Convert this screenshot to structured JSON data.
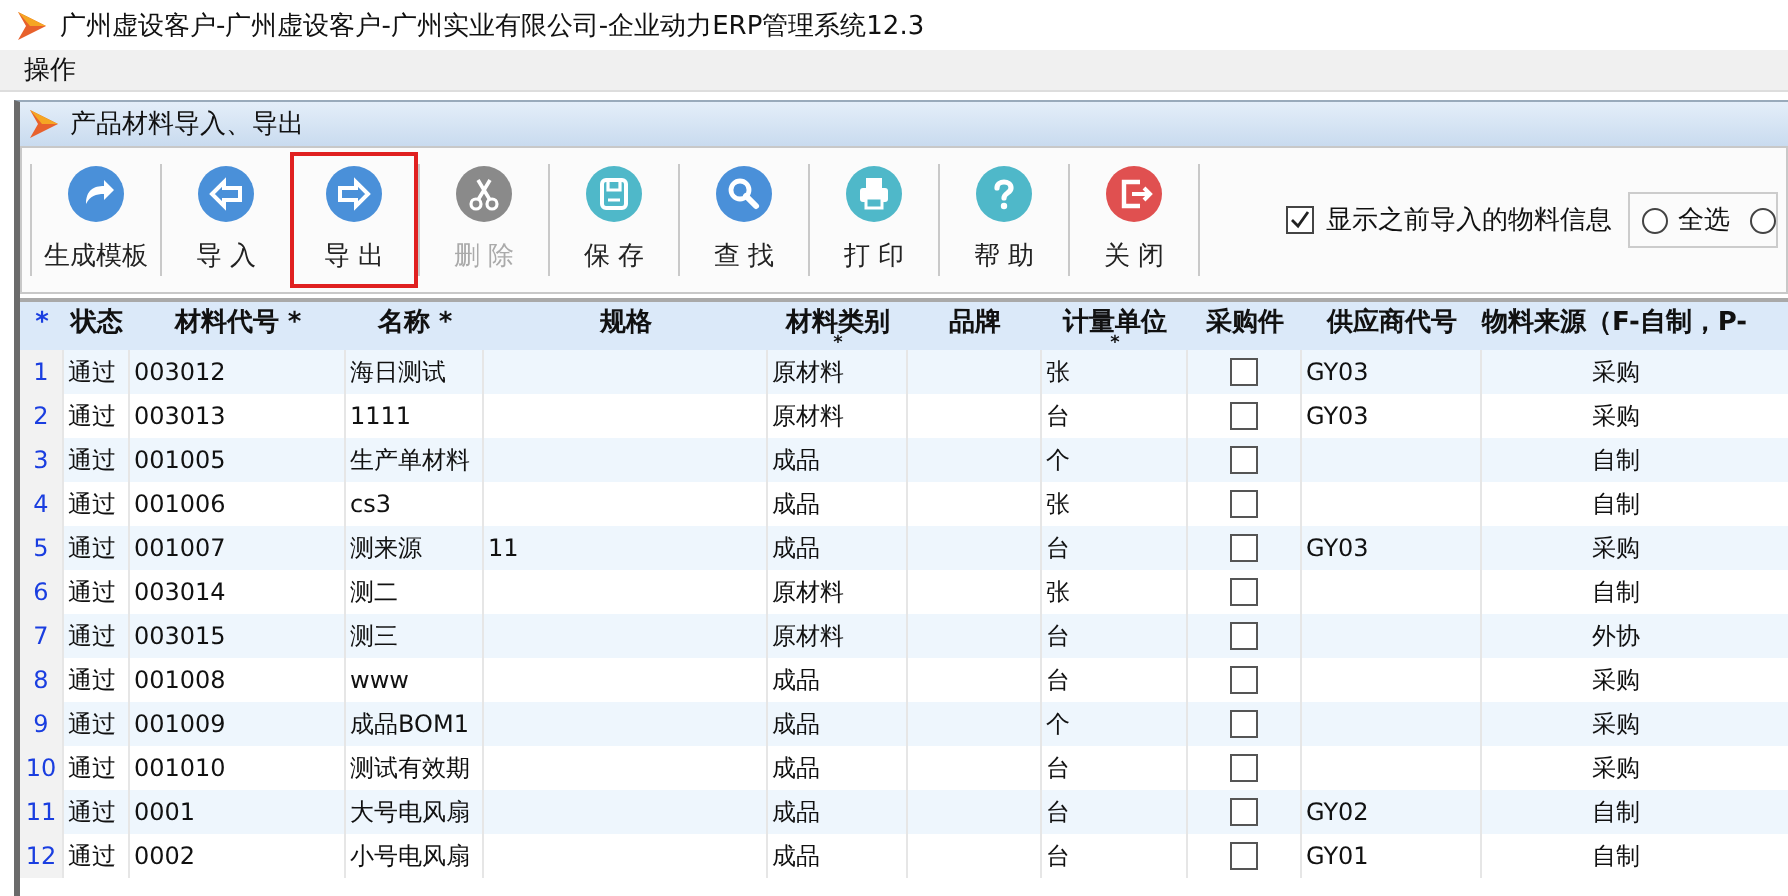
{
  "window": {
    "title": "广州虚设客户-广州虚设客户-广州实业有限公司-企业动力ERP管理系统12.3"
  },
  "menu": [
    "操作"
  ],
  "subwindow": {
    "title": "产品材料导入、导出"
  },
  "toolbar": [
    {
      "kind": "template",
      "label": "生成模板",
      "disabled": false,
      "highlighted": false
    },
    {
      "kind": "import",
      "label": "导 入",
      "disabled": false,
      "highlighted": false
    },
    {
      "kind": "export",
      "label": "导 出",
      "disabled": false,
      "highlighted": true
    },
    {
      "kind": "delete",
      "label": "删 除",
      "disabled": true,
      "highlighted": false
    },
    {
      "kind": "save",
      "label": "保 存",
      "disabled": false,
      "highlighted": false
    },
    {
      "kind": "find",
      "label": "查 找",
      "disabled": false,
      "highlighted": false
    },
    {
      "kind": "print",
      "label": "打 印",
      "disabled": false,
      "highlighted": false
    },
    {
      "kind": "help",
      "label": "帮 助",
      "disabled": false,
      "highlighted": false
    },
    {
      "kind": "close",
      "label": "关 闭",
      "disabled": false,
      "highlighted": false
    }
  ],
  "show_previous": {
    "label": "显示之前导入的物料信息",
    "checked": true
  },
  "radios": [
    {
      "label": "全选",
      "selected": false
    },
    {
      "selected": false
    }
  ],
  "table": {
    "columns": [
      {
        "label": "*"
      },
      {
        "label": "状态"
      },
      {
        "label": "材料代号",
        "mark": "*"
      },
      {
        "label": "名称",
        "mark": "*"
      },
      {
        "label": "规格"
      },
      {
        "label": "材料类别",
        "mark_below": "*"
      },
      {
        "label": "品牌"
      },
      {
        "label": "计量单位",
        "mark_below": "*"
      },
      {
        "label": "采购件"
      },
      {
        "label": "供应商代号"
      },
      {
        "label": "物料来源（F-自制，P-"
      }
    ],
    "rows": [
      {
        "no": "1",
        "status": "通过",
        "code": "003012",
        "name": "海日测试",
        "spec": "",
        "category": "原材料",
        "brand": "",
        "unit": "张",
        "purchased": false,
        "supplier": "GY03",
        "source": "采购"
      },
      {
        "no": "2",
        "status": "通过",
        "code": "003013",
        "name": "1111",
        "spec": "",
        "category": "原材料",
        "brand": "",
        "unit": "台",
        "purchased": false,
        "supplier": "GY03",
        "source": "采购"
      },
      {
        "no": "3",
        "status": "通过",
        "code": "001005",
        "name": "生产单材料",
        "spec": "",
        "category": "成品",
        "brand": "",
        "unit": "个",
        "purchased": false,
        "supplier": "",
        "source": "自制"
      },
      {
        "no": "4",
        "status": "通过",
        "code": "001006",
        "name": "cs3",
        "spec": "",
        "category": "成品",
        "brand": "",
        "unit": "张",
        "purchased": false,
        "supplier": "",
        "source": "自制"
      },
      {
        "no": "5",
        "status": "通过",
        "code": "001007",
        "name": "测来源",
        "spec": "11",
        "category": "成品",
        "brand": "",
        "unit": "台",
        "purchased": false,
        "supplier": "GY03",
        "source": "采购"
      },
      {
        "no": "6",
        "status": "通过",
        "code": "003014",
        "name": "测二",
        "spec": "",
        "category": "原材料",
        "brand": "",
        "unit": "张",
        "purchased": false,
        "supplier": "",
        "source": "自制"
      },
      {
        "no": "7",
        "status": "通过",
        "code": "003015",
        "name": "测三",
        "spec": "",
        "category": "原材料",
        "brand": "",
        "unit": "台",
        "purchased": false,
        "supplier": "",
        "source": "外协"
      },
      {
        "no": "8",
        "status": "通过",
        "code": "001008",
        "name": "www",
        "spec": "",
        "category": "成品",
        "brand": "",
        "unit": "台",
        "purchased": false,
        "supplier": "",
        "source": "采购"
      },
      {
        "no": "9",
        "status": "通过",
        "code": "001009",
        "name": "成品BOM1",
        "spec": "",
        "category": "成品",
        "brand": "",
        "unit": "个",
        "purchased": false,
        "supplier": "",
        "source": "采购"
      },
      {
        "no": "10",
        "status": "通过",
        "code": "001010",
        "name": "测试有效期",
        "spec": "",
        "category": "成品",
        "brand": "",
        "unit": "台",
        "purchased": false,
        "supplier": "",
        "source": "采购"
      },
      {
        "no": "11",
        "status": "通过",
        "code": "0001",
        "name": "大号电风扇",
        "spec": "",
        "category": "成品",
        "brand": "",
        "unit": "台",
        "purchased": false,
        "supplier": "GY02",
        "source": "自制"
      },
      {
        "no": "12",
        "status": "通过",
        "code": "0002",
        "name": "小号电风扇",
        "spec": "",
        "category": "成品",
        "brand": "",
        "unit": "台",
        "purchased": false,
        "supplier": "GY01",
        "source": "自制"
      }
    ]
  }
}
